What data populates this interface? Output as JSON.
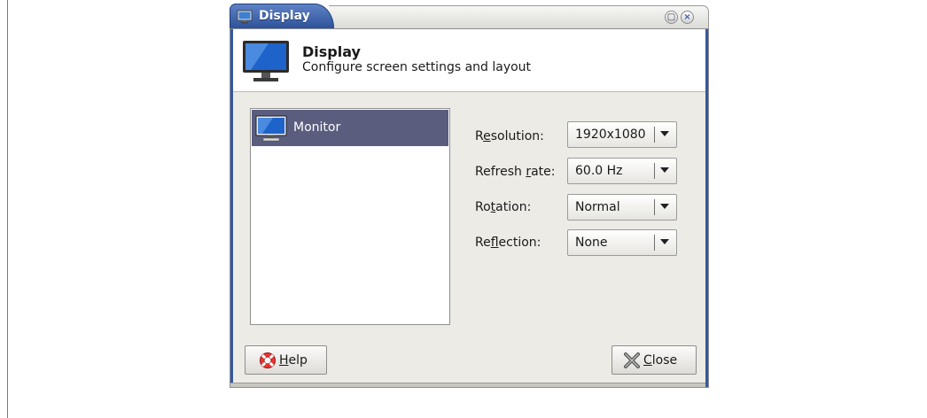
{
  "window": {
    "title": "Display",
    "controls": [
      "maximize-icon",
      "close-icon"
    ]
  },
  "header": {
    "icon": "display-monitor-icon",
    "title": "Display",
    "subtitle": "Configure screen settings and layout"
  },
  "outputs": {
    "items": [
      {
        "label": "Monitor",
        "icon": "monitor-icon",
        "selected": true
      }
    ]
  },
  "settings": {
    "resolution": {
      "label_pre": "R",
      "label_mn": "e",
      "label_post": "solution:",
      "value": "1920x1080"
    },
    "refresh": {
      "label_pre": "Refresh ",
      "label_mn": "r",
      "label_post": "ate:",
      "value": "60.0 Hz"
    },
    "rotation": {
      "label_pre": "Ro",
      "label_mn": "t",
      "label_post": "ation:",
      "value": "Normal"
    },
    "reflection": {
      "label_pre": "Re",
      "label_mn": "f",
      "label_post": "lection:",
      "value": "None"
    }
  },
  "buttons": {
    "help": {
      "mn": "H",
      "rest": "elp",
      "icon": "lifebuoy-icon"
    },
    "close": {
      "mn": "C",
      "rest": "lose",
      "icon": "close-x-icon"
    }
  },
  "colors": {
    "titlebar_accent": "#2e529a",
    "selection": "#5a5d7e"
  }
}
